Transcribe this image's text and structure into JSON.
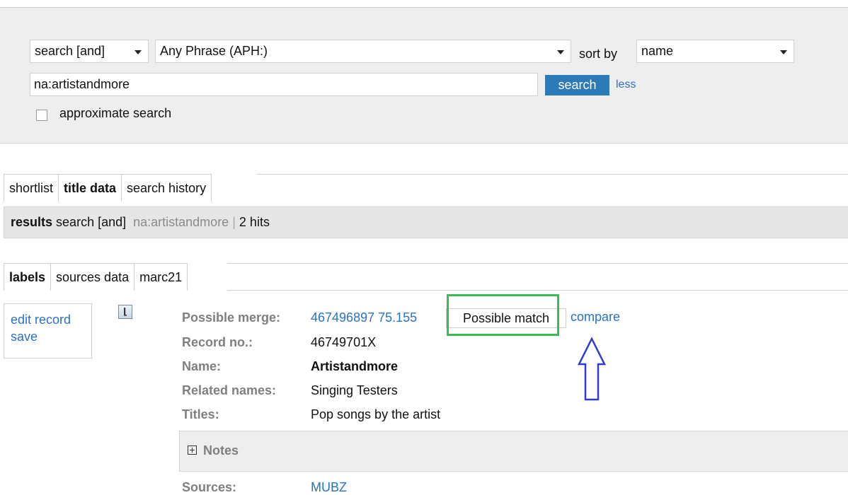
{
  "search": {
    "mode_select": "search [and]",
    "index_select": "Any Phrase (APH:)",
    "sort_label": "sort by",
    "sort_select": "name",
    "query_value": "na:artistandmore",
    "search_button": "search",
    "less_link": "less",
    "approximate_label": "approximate search",
    "approximate_checked": false
  },
  "top_tabs": [
    "shortlist",
    "title data",
    "search history"
  ],
  "top_tabs_active": "title data",
  "results": {
    "label": "results",
    "mode": "search [and]",
    "query": "na:artistandmore",
    "separator": "|",
    "hits": "2 hits"
  },
  "view_tabs": [
    "labels",
    "sources data",
    "marc21"
  ],
  "view_tabs_active": "labels",
  "actions": {
    "edit_record": "edit record",
    "save": "save"
  },
  "record": {
    "possible_merge_label": "Possible merge:",
    "possible_merge_value": "467496897 75.155",
    "possible_match_button": "Possible match",
    "compare_link": "compare",
    "record_no_label": "Record no.:",
    "record_no_value": "46749701X",
    "name_label": "Name:",
    "name_value": "Artistandmore",
    "related_label": "Related names:",
    "related_value": "Singing Testers",
    "titles_label": "Titles:",
    "titles_value": "Pop songs by the artist",
    "notes_label": "Notes",
    "sources_label": "Sources:",
    "sources_value": "MUBZ"
  },
  "colors": {
    "link": "#2a72c6",
    "search_button": "#2c7ab8",
    "highlight_box": "#3cba54",
    "annotation_arrow": "#2f3bd1"
  }
}
